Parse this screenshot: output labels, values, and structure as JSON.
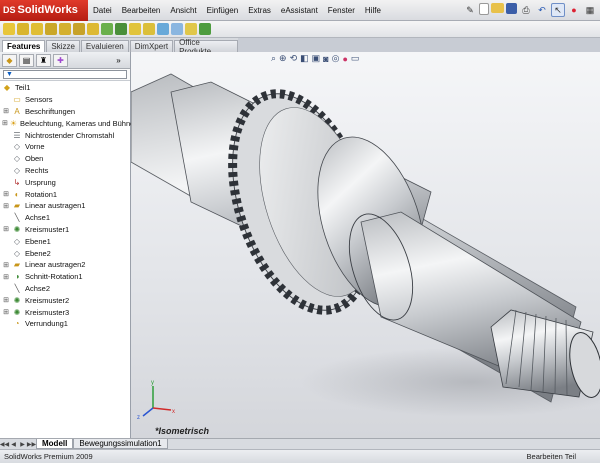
{
  "app": {
    "logo": "SolidWorks"
  },
  "menu": [
    "Datei",
    "Bearbeiten",
    "Ansicht",
    "Einfügen",
    "Extras",
    "eAssistant",
    "Fenster",
    "Hilfe"
  ],
  "command_tabs": [
    "Features",
    "Skizze",
    "Evaluieren",
    "DimXpert",
    "Office Produkte"
  ],
  "active_command_tab": "Features",
  "tree": {
    "root": "Teil1",
    "items": [
      {
        "label": "Sensors",
        "icon": "sensor-folder-icon",
        "expandable": false
      },
      {
        "label": "Beschriftungen",
        "icon": "annotations-icon",
        "expandable": true
      },
      {
        "label": "Beleuchtung, Kameras und Bühne",
        "icon": "lights-icon",
        "expandable": true
      },
      {
        "label": "Nichtrostender Chromstahl",
        "icon": "material-icon",
        "expandable": false
      },
      {
        "label": "Vorne",
        "icon": "plane-icon",
        "expandable": false
      },
      {
        "label": "Oben",
        "icon": "plane-icon",
        "expandable": false
      },
      {
        "label": "Rechts",
        "icon": "plane-icon",
        "expandable": false
      },
      {
        "label": "Ursprung",
        "icon": "origin-icon",
        "expandable": false
      },
      {
        "label": "Rotation1",
        "icon": "revolve-icon",
        "expandable": true
      },
      {
        "label": "Linear austragen1",
        "icon": "extrude-icon",
        "expandable": true
      },
      {
        "label": "Achse1",
        "icon": "axis-icon",
        "expandable": false
      },
      {
        "label": "Kreismuster1",
        "icon": "circular-pattern-icon",
        "expandable": true
      },
      {
        "label": "Ebene1",
        "icon": "plane-icon",
        "expandable": false
      },
      {
        "label": "Ebene2",
        "icon": "plane-icon",
        "expandable": false
      },
      {
        "label": "Linear austragen2",
        "icon": "extrude-icon",
        "expandable": true
      },
      {
        "label": "Schnitt-Rotation1",
        "icon": "cut-revolve-icon",
        "expandable": true
      },
      {
        "label": "Achse2",
        "icon": "axis-icon",
        "expandable": false
      },
      {
        "label": "Kreismuster2",
        "icon": "circular-pattern-icon",
        "expandable": true
      },
      {
        "label": "Kreismuster3",
        "icon": "circular-pattern-icon",
        "expandable": true
      },
      {
        "label": "Verrundung1",
        "icon": "fillet-icon",
        "expandable": false
      }
    ]
  },
  "viewport": {
    "view_name": "*Isometrisch"
  },
  "bottom_tabs": [
    "Modell",
    "Bewegungssimulation1"
  ],
  "active_bottom_tab": "Modell",
  "status": {
    "left": "SolidWorks Premium 2009",
    "right": "Bearbeiten Teil"
  },
  "colors": {
    "logo_red": "#c8281a",
    "tree_blue": "#0a5bc0",
    "viewport_bg": "#e8e9ec"
  }
}
